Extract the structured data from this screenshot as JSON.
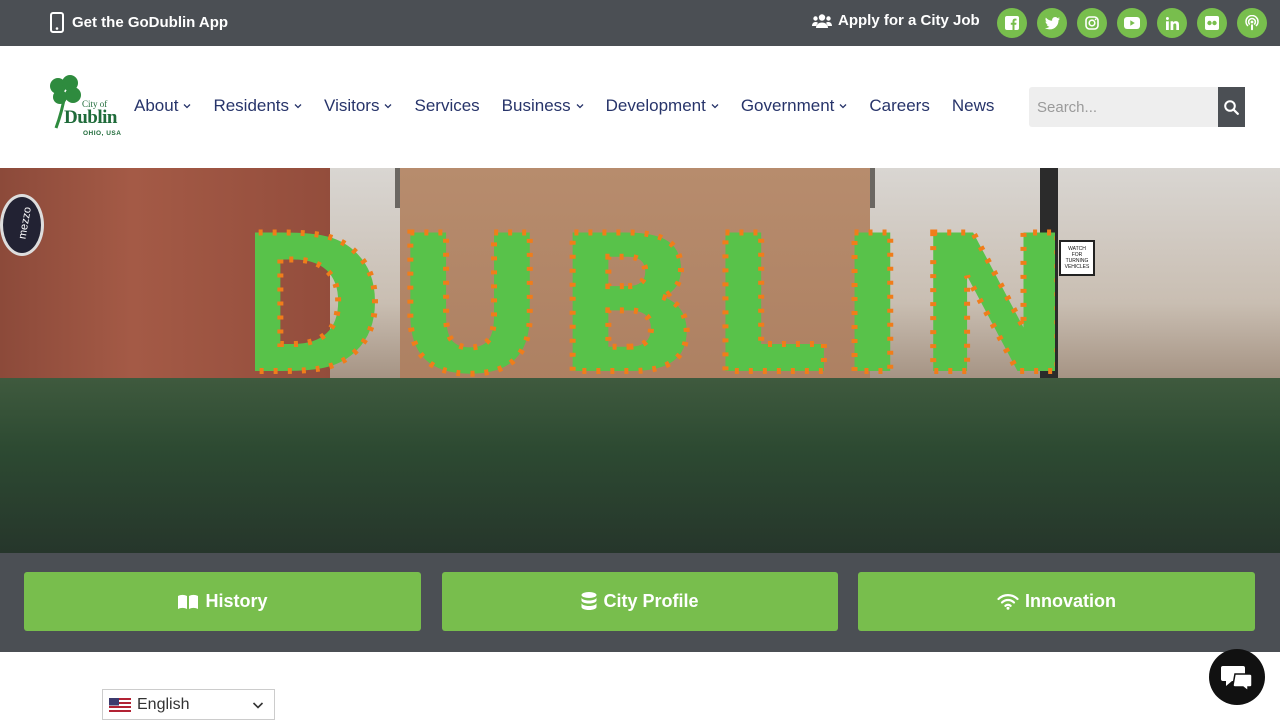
{
  "topbar": {
    "app_label": "Get the GoDublin App",
    "job_label": "Apply for a City Job",
    "social_icons": [
      "facebook-icon",
      "twitter-icon",
      "instagram-icon",
      "youtube-icon",
      "linkedin-icon",
      "flickr-icon",
      "podcast-icon"
    ]
  },
  "logo": {
    "city_of": "City of",
    "name": "Dublin",
    "region": "OHIO, USA"
  },
  "nav": {
    "items": [
      {
        "label": "About",
        "dropdown": true
      },
      {
        "label": "Residents",
        "dropdown": true
      },
      {
        "label": "Visitors",
        "dropdown": true
      },
      {
        "label": "Services",
        "dropdown": false
      },
      {
        "label": "Business",
        "dropdown": true
      },
      {
        "label": "Development",
        "dropdown": true
      },
      {
        "label": "Government",
        "dropdown": true
      },
      {
        "label": "Careers",
        "dropdown": false
      },
      {
        "label": "News",
        "dropdown": false
      }
    ]
  },
  "search": {
    "placeholder": "Search..."
  },
  "hero": {
    "balloon_word": "DUBLIN",
    "storefront_sign": "mezzo",
    "street_sign": [
      "WATCH",
      "FOR",
      "TURNING",
      "VEHICLES"
    ]
  },
  "quick_links": [
    {
      "label": "History",
      "icon": "book-icon"
    },
    {
      "label": "City Profile",
      "icon": "database-icon"
    },
    {
      "label": "Innovation",
      "icon": "wifi-icon"
    }
  ],
  "language": {
    "selected": "English"
  },
  "colors": {
    "dark_gray": "#4b4f54",
    "green": "#78be4d",
    "nav_text": "#27346a"
  }
}
